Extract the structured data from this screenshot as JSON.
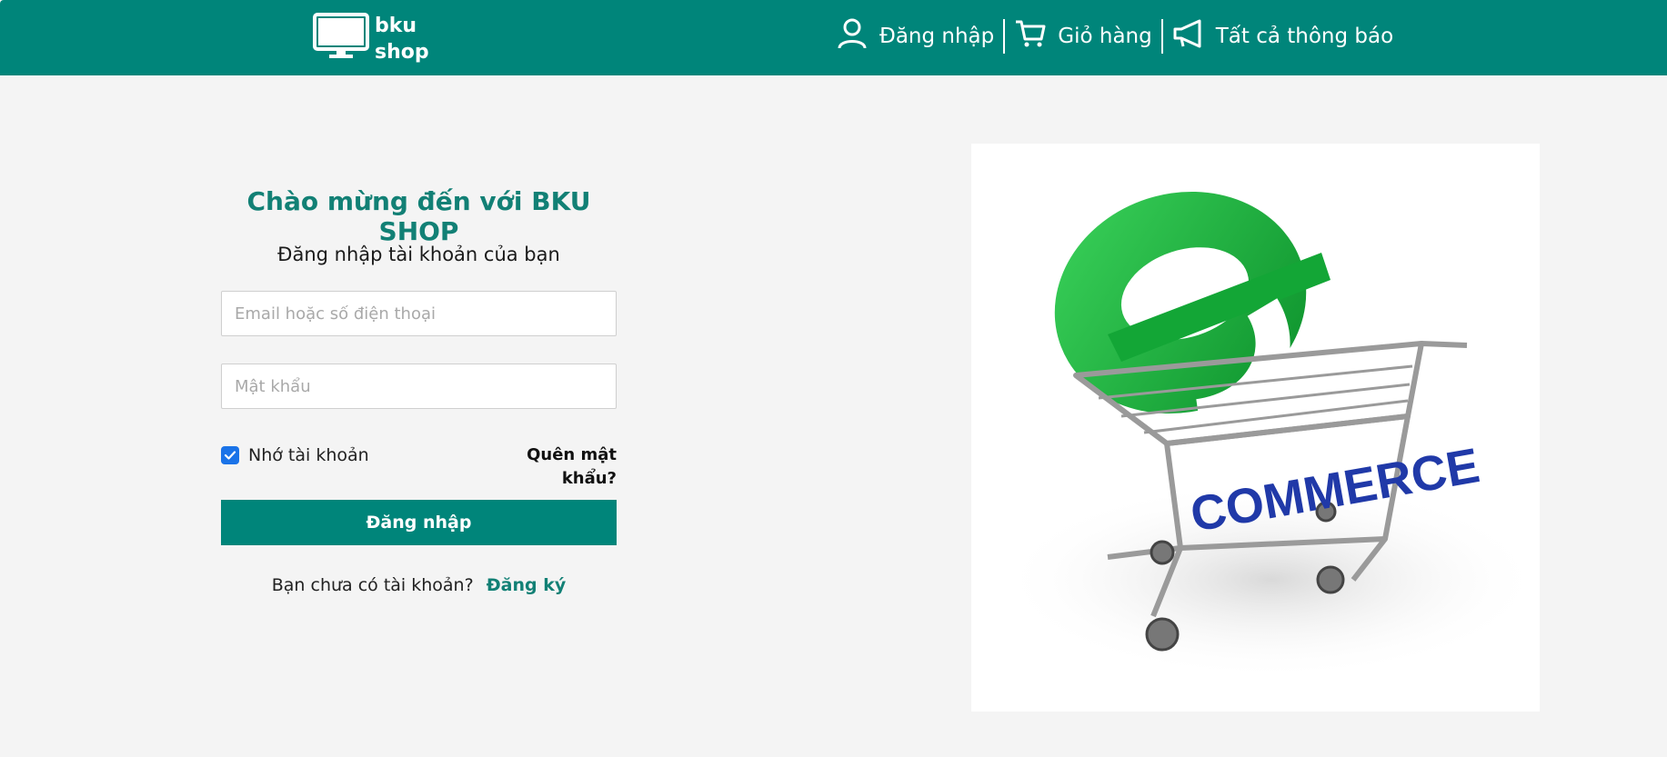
{
  "header": {
    "logo": {
      "line1": "bku",
      "line2": "shop",
      "icon": "monitor-icon"
    },
    "nav": [
      {
        "label": "Đăng nhập",
        "icon": "user-icon"
      },
      {
        "label": "Giỏ hàng",
        "icon": "cart-icon"
      },
      {
        "label": "Tất cả thông báo",
        "icon": "megaphone-icon"
      }
    ],
    "color": "#00857a"
  },
  "login": {
    "title": "Chào mừng đến với BKU SHOP",
    "subtitle": "Đăng nhập tài khoản của bạn",
    "email_placeholder": "Email hoặc số điện thoại",
    "password_placeholder": "Mật khẩu",
    "remember_label": "Nhớ tài khoản",
    "remember_checked": true,
    "forgot_label": "Quên mật khẩu?",
    "submit_label": "Đăng nhập",
    "signup_prompt": "Bạn chưa có tài khoản?",
    "signup_link": "Đăng ký"
  },
  "hero": {
    "cart_text": "COMMERCE",
    "letter": "e"
  }
}
